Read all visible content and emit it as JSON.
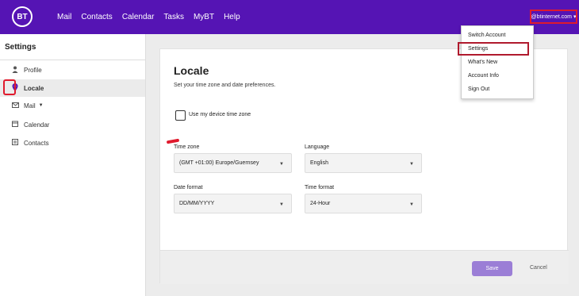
{
  "header": {
    "logo": "BT",
    "nav": [
      "Mail",
      "Contacts",
      "Calendar",
      "Tasks",
      "MyBT",
      "Help"
    ],
    "account": "@btinternet.com ▾"
  },
  "sidebar": {
    "title": "Settings",
    "items": [
      {
        "label": "Profile",
        "icon": "person-icon"
      },
      {
        "label": "Locale",
        "icon": "location-pin-icon"
      },
      {
        "label": "Mail",
        "icon": "mail-icon"
      },
      {
        "label": "Calendar",
        "icon": "calendar-icon"
      },
      {
        "label": "Contacts",
        "icon": "contacts-icon"
      }
    ]
  },
  "locale": {
    "title": "Locale",
    "subtitle": "Set your time zone and date preferences.",
    "device_tz_label": "Use my device time zone",
    "device_tz_checked": false,
    "fields": {
      "timezone": {
        "label": "Time zone",
        "value": "(GMT +01:00) Europe/Guernsey"
      },
      "language": {
        "label": "Language",
        "value": "English"
      },
      "date_format": {
        "label": "Date format",
        "value": "DD/MM/YYYY"
      },
      "time_format": {
        "label": "Time format",
        "value": "24-Hour"
      }
    },
    "save": "Save",
    "cancel": "Cancel"
  },
  "account_menu": {
    "items": [
      "Switch Account",
      "Settings",
      "What's New",
      "Account Info",
      "Sign Out"
    ],
    "highlighted": "Settings"
  },
  "colors": {
    "brand": "#5514b4",
    "highlight": "#e01a2d",
    "save_button": "#9b7ed6"
  }
}
